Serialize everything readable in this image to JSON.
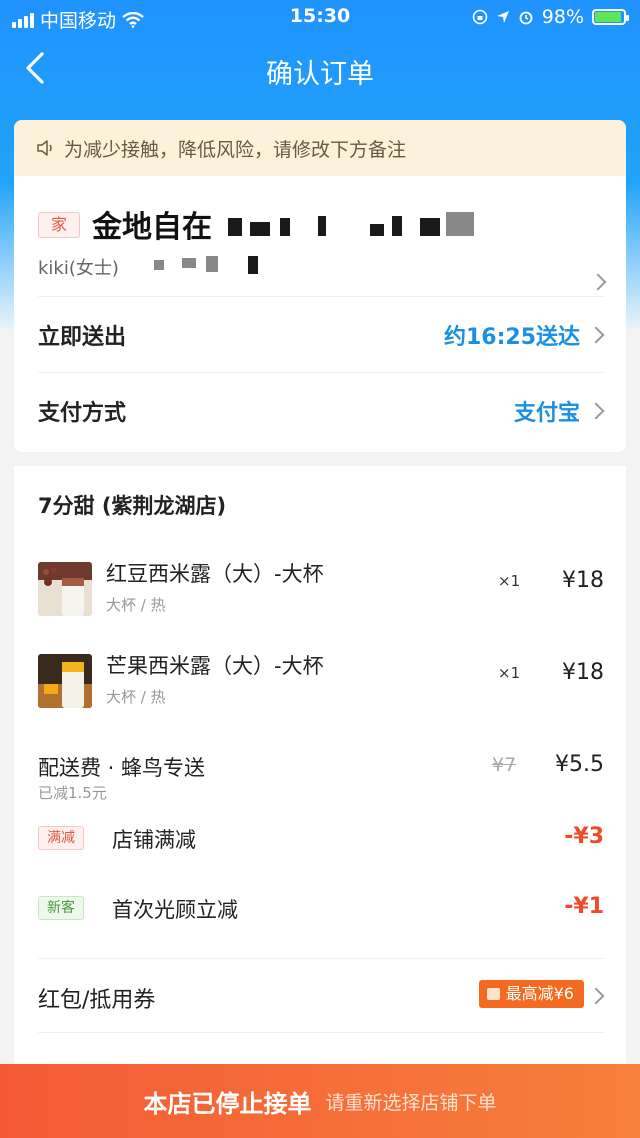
{
  "status_bar": {
    "carrier": "中国移动",
    "time": "15:30",
    "battery": "98%"
  },
  "nav": {
    "title": "确认订单"
  },
  "notice": {
    "text": "为减少接触，降低风险，请修改下方备注"
  },
  "address": {
    "tag": "家",
    "name": "金地自在",
    "contact": "kiki(女士)"
  },
  "delivery": {
    "label": "立即送出",
    "value": "约16:25送达"
  },
  "payment": {
    "label": "支付方式",
    "value": "支付宝"
  },
  "order": {
    "shop_name": "7分甜 (紫荆龙湖店)",
    "items": [
      {
        "name": "红豆西米露（大）-大杯",
        "spec": "大杯 / 热",
        "qty": "×1",
        "price": "¥18"
      },
      {
        "name": "芒果西米露（大）-大杯",
        "spec": "大杯 / 热",
        "qty": "×1",
        "price": "¥18"
      }
    ],
    "delivery_fee": {
      "label": "配送费 · 蜂鸟专送",
      "saved": "已减1.5元",
      "original": "¥7",
      "price": "¥5.5"
    },
    "promotions": [
      {
        "tag": "满减",
        "label": "店铺满减",
        "amount": "-¥3"
      },
      {
        "tag": "新客",
        "label": "首次光顾立减",
        "amount": "-¥1"
      }
    ],
    "coupon": {
      "label": "红包/抵用券",
      "badge": "最高减¥6"
    }
  },
  "bottom_bar": {
    "main": "本店已停止接单",
    "sub": "请重新选择店铺下单"
  },
  "colors": {
    "header_blue": "#1f93ff",
    "link_blue": "#1a8fe3",
    "discount_red": "#ef4b2b",
    "coupon_orange": "#f46a21",
    "bottom_orange": "#f45a36"
  }
}
